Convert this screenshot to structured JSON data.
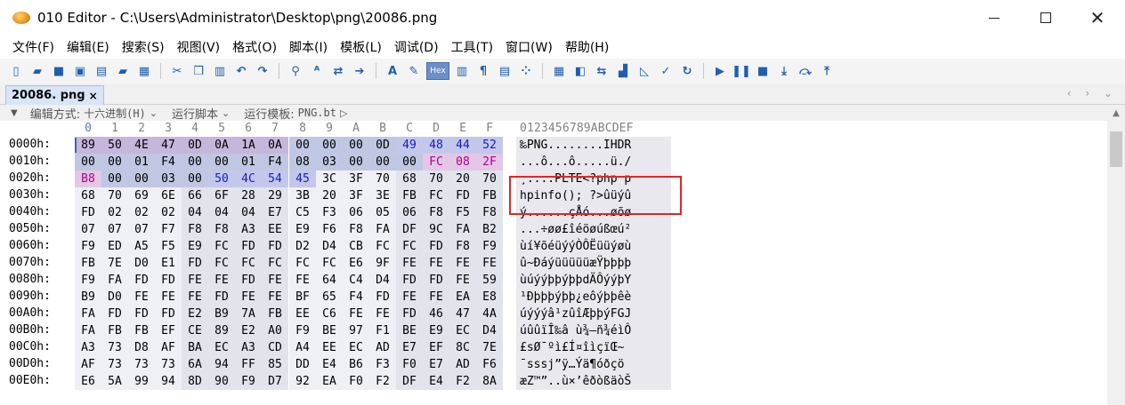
{
  "window": {
    "title": "010 Editor - C:\\Users\\Administrator\\Desktop\\png\\20086.png",
    "app_icon": "melon-app-icon",
    "controls": [
      "minimize",
      "maximize",
      "close"
    ]
  },
  "menu": [
    "文件(F)",
    "编辑(E)",
    "搜索(S)",
    "视图(V)",
    "格式(O)",
    "脚本(I)",
    "模板(L)",
    "调试(D)",
    "工具(T)",
    "窗口(W)",
    "帮助(H)"
  ],
  "toolbar": {
    "icons": [
      "new-file-icon",
      "open-folder-icon",
      "save-icon",
      "save-as-icon",
      "save-all-icon",
      "open-folder2-icon",
      "workspace-icon",
      "cut-icon",
      "copy-icon",
      "paste-icon",
      "undo-icon",
      "redo-icon",
      "find-icon",
      "replace-icon",
      "find-in-files-icon",
      "goto-icon",
      "text-view-icon",
      "edit-icon",
      "hex-view-icon",
      "column-icon",
      "pilcrow-icon",
      "columns-icon",
      "binary-icon",
      "calculator-icon",
      "inspector-icon",
      "compare-icon",
      "histogram-icon",
      "chart-icon",
      "checksum-icon",
      "refresh-icon",
      "run-icon",
      "pause-icon",
      "stop-icon",
      "step-into-icon",
      "step-over-icon",
      "step-out-icon"
    ],
    "hex_label": "Hex"
  },
  "tab": {
    "label": "20086. png",
    "close": "×"
  },
  "editor_options": {
    "edit_mode_label": "编辑方式:",
    "edit_mode_value": "十六进制(H)",
    "run_script_label": "运行脚本",
    "run_template_label": "运行模板:",
    "run_template_value": "PNG.bt"
  },
  "hex": {
    "column_headers": [
      "0",
      "1",
      "2",
      "3",
      "4",
      "5",
      "6",
      "7",
      "8",
      "9",
      "A",
      "B",
      "C",
      "D",
      "E",
      "F"
    ],
    "ascii_header": "0123456789ABCDEF",
    "rows": [
      {
        "addr": "0000h:",
        "bytes": [
          "89",
          "50",
          "4E",
          "47",
          "0D",
          "0A",
          "1A",
          "0A",
          "00",
          "00",
          "00",
          "0D",
          "49",
          "48",
          "44",
          "52"
        ],
        "ascii": "‰PNG........IHDR"
      },
      {
        "addr": "0010h:",
        "bytes": [
          "00",
          "00",
          "01",
          "F4",
          "00",
          "00",
          "01",
          "F4",
          "08",
          "03",
          "00",
          "00",
          "00",
          "FC",
          "08",
          "2F"
        ],
        "ascii": "...ô...ô.....ü./"
      },
      {
        "addr": "0020h:",
        "bytes": [
          "B8",
          "00",
          "00",
          "03",
          "00",
          "50",
          "4C",
          "54",
          "45",
          "3C",
          "3F",
          "70",
          "68",
          "70",
          "20",
          "70"
        ],
        "ascii": "¸....PLTE<?php p"
      },
      {
        "addr": "0030h:",
        "bytes": [
          "68",
          "70",
          "69",
          "6E",
          "66",
          "6F",
          "28",
          "29",
          "3B",
          "20",
          "3F",
          "3E",
          "FB",
          "FC",
          "FD",
          "FB"
        ],
        "ascii": "hpinfo(); ?>ûüýû"
      },
      {
        "addr": "0040h:",
        "bytes": [
          "FD",
          "02",
          "02",
          "02",
          "04",
          "04",
          "04",
          "E7",
          "C5",
          "F3",
          "06",
          "05",
          "06",
          "F8",
          "F5",
          "F8"
        ],
        "ascii": "ý......çÅó...øõø"
      },
      {
        "addr": "0050h:",
        "bytes": [
          "07",
          "07",
          "07",
          "F7",
          "F8",
          "F8",
          "A3",
          "EE",
          "E9",
          "F6",
          "F8",
          "FA",
          "DF",
          "9C",
          "FA",
          "B2"
        ],
        "ascii": "...÷øø£îéöøúßœú²"
      },
      {
        "addr": "0060h:",
        "bytes": [
          "F9",
          "ED",
          "A5",
          "F5",
          "E9",
          "FC",
          "FD",
          "FD",
          "D2",
          "D4",
          "CB",
          "FC",
          "FC",
          "FD",
          "F8",
          "F9"
        ],
        "ascii": "ùí¥õéüýýÒÔËüüýøù"
      },
      {
        "addr": "0070h:",
        "bytes": [
          "FB",
          "7E",
          "D0",
          "E1",
          "FD",
          "FC",
          "FC",
          "FC",
          "FC",
          "FC",
          "E6",
          "9F",
          "FE",
          "FE",
          "FE",
          "FE"
        ],
        "ascii": "û~ÐáýüüüüüæŸþþþþ"
      },
      {
        "addr": "0080h:",
        "bytes": [
          "F9",
          "FA",
          "FD",
          "FD",
          "FE",
          "FE",
          "FD",
          "FE",
          "FE",
          "64",
          "C4",
          "D4",
          "FD",
          "FD",
          "FE",
          "59"
        ],
        "ascii": "ùúýýþþýþþdÄÔýýþY"
      },
      {
        "addr": "0090h:",
        "bytes": [
          "B9",
          "D0",
          "FE",
          "FE",
          "FE",
          "FD",
          "FE",
          "FE",
          "BF",
          "65",
          "F4",
          "FD",
          "FE",
          "FE",
          "EA",
          "E8"
        ],
        "ascii": "¹Ðþþþýþþ¿eôýþþêè"
      },
      {
        "addr": "00A0h:",
        "bytes": [
          "FA",
          "FD",
          "FD",
          "FD",
          "E2",
          "B9",
          "7A",
          "FB",
          "EE",
          "C6",
          "FE",
          "FE",
          "FD",
          "46",
          "47",
          "4A"
        ],
        "ascii": "úýýýâ¹zûîÆþþýFGJ"
      },
      {
        "addr": "00B0h:",
        "bytes": [
          "FA",
          "FB",
          "FB",
          "EF",
          "CE",
          "89",
          "E2",
          "A0",
          "F9",
          "BE",
          "97",
          "F1",
          "BE",
          "E9",
          "EC",
          "D4"
        ],
        "ascii": "úûûïÎ‰â ù¾—ñ¾éìÔ"
      },
      {
        "addr": "00C0h:",
        "bytes": [
          "A3",
          "73",
          "D8",
          "AF",
          "BA",
          "EC",
          "A3",
          "CD",
          "A4",
          "EE",
          "EC",
          "AD",
          "E7",
          "EF",
          "8C",
          "7E"
        ],
        "ascii": "£sØ¯ºì£Í¤îì­çïŒ~"
      },
      {
        "addr": "00D0h:",
        "bytes": [
          "AF",
          "73",
          "73",
          "73",
          "6A",
          "94",
          "FF",
          "85",
          "DD",
          "E4",
          "B6",
          "F3",
          "F0",
          "E7",
          "AD",
          "F6"
        ],
        "ascii": "¯sssj”ÿ…Ýä¶óðç­ö"
      },
      {
        "addr": "00E0h:",
        "bytes": [
          "E6",
          "5A",
          "99",
          "94",
          "8D",
          "90",
          "F9",
          "D7",
          "92",
          "EA",
          "F0",
          "F2",
          "DF",
          "E4",
          "F2",
          "8A"
        ],
        "ascii": "æZ™”..ù×’êðòßäòŠ"
      }
    ]
  },
  "highlight_colors": {
    "accent": "#3a63b5",
    "annotation_box": "#e0262a"
  }
}
